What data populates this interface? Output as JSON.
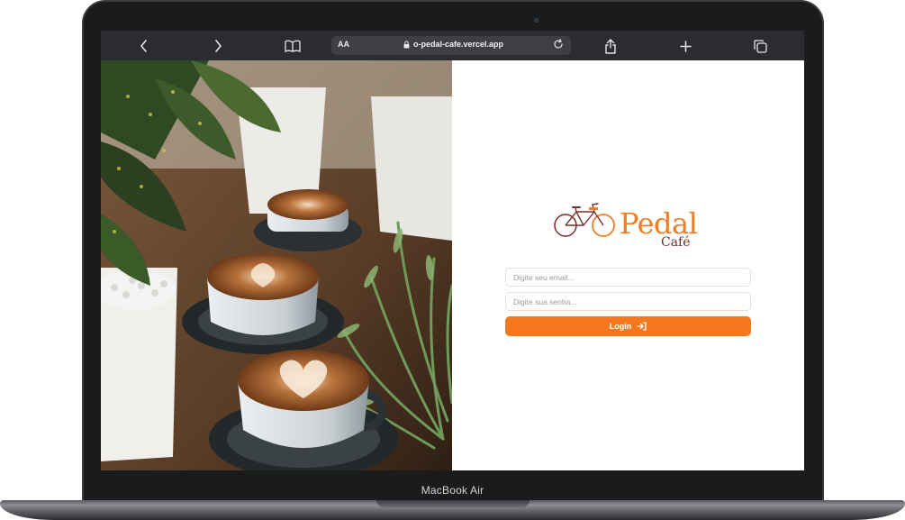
{
  "device": {
    "model_label": "MacBook Air"
  },
  "browser": {
    "text_size_label": "AA",
    "url": "o-pedal-cafe.vercel.app",
    "icons": [
      "chevron-left-icon",
      "chevron-right-icon",
      "book-icon",
      "lock-icon",
      "reload-icon",
      "share-icon",
      "plus-icon",
      "tabs-icon"
    ]
  },
  "login": {
    "brand_name": "Pedal",
    "brand_sub": "Café",
    "email_placeholder": "Digite seu email...",
    "password_placeholder": "Digite sua senha...",
    "login_label": "Login",
    "login_icon": "sign-in-icon"
  },
  "colors": {
    "accent": "#f5771e",
    "brand_dark": "#6a2d26",
    "toolbar_bg": "#2b2c2f",
    "frame": "#1a1b1d"
  }
}
